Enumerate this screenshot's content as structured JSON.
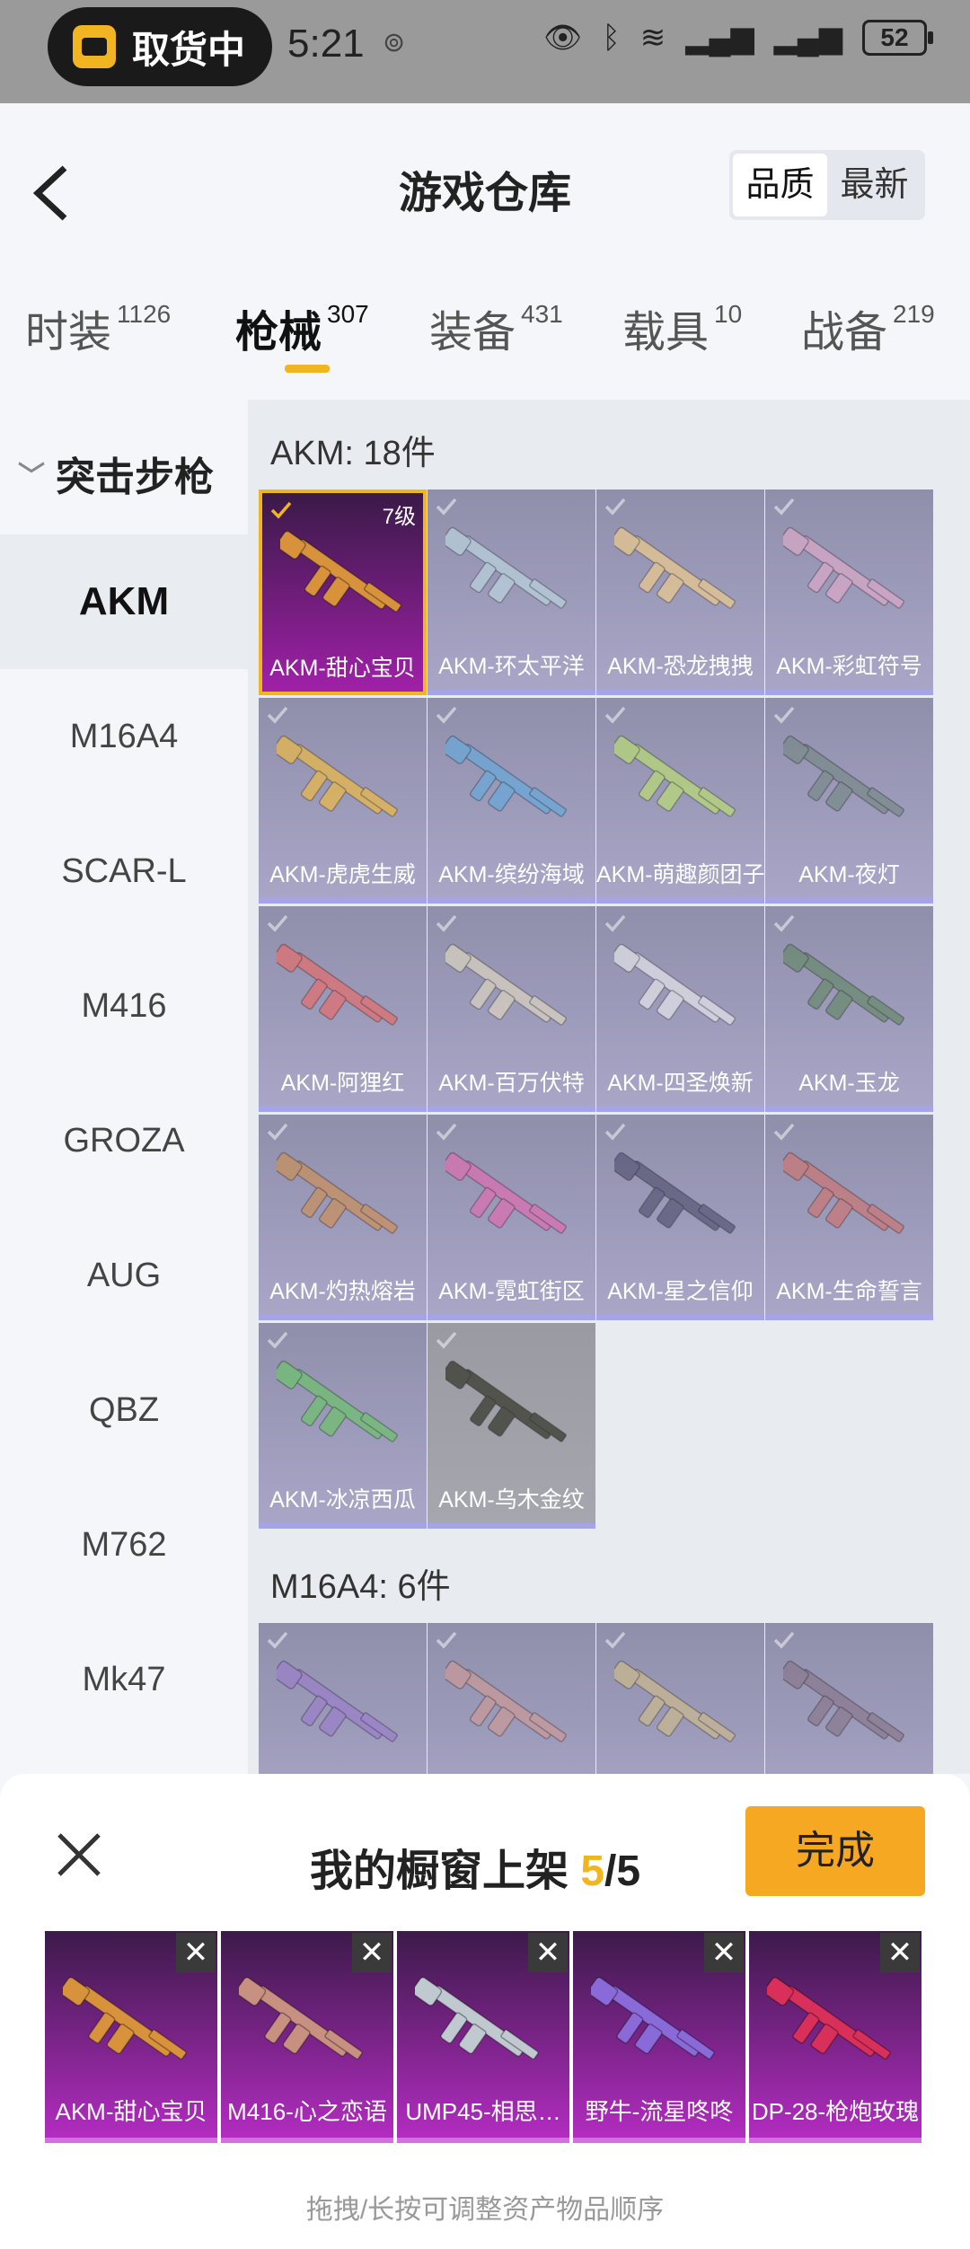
{
  "status": {
    "pill_text": "取货中",
    "time": "5:21",
    "battery": "52"
  },
  "header": {
    "title": "游戏仓库",
    "sort_options": [
      "品质",
      "最新"
    ]
  },
  "tabs": [
    {
      "label": "时装",
      "count": "1126"
    },
    {
      "label": "枪械",
      "count": "307"
    },
    {
      "label": "装备",
      "count": "431"
    },
    {
      "label": "载具",
      "count": "10"
    },
    {
      "label": "战备",
      "count": "219"
    }
  ],
  "sidebar": {
    "category": "突击步枪",
    "items": [
      "AKM",
      "M16A4",
      "SCAR-L",
      "M416",
      "GROZA",
      "AUG",
      "QBZ",
      "M762",
      "Mk47"
    ]
  },
  "sections": [
    {
      "title": "AKM: 18件",
      "items": [
        {
          "name": "AKM-甜心宝贝",
          "level": "7级",
          "color": "#d8923c"
        },
        {
          "name": "AKM-环太平洋",
          "color": "#b8d0dc"
        },
        {
          "name": "AKM-恐龙拽拽",
          "color": "#e8c890"
        },
        {
          "name": "AKM-彩虹符号",
          "color": "#d8a8c8"
        },
        {
          "name": "AKM-虎虎生威",
          "color": "#e8b84c"
        },
        {
          "name": "AKM-缤纷海域",
          "color": "#6aa8d8"
        },
        {
          "name": "AKM-萌趣颜团子",
          "color": "#b8d878"
        },
        {
          "name": "AKM-夜灯",
          "color": "#7a8a8a"
        },
        {
          "name": "AKM-阿狸红",
          "color": "#e07070"
        },
        {
          "name": "AKM-百万伏特",
          "color": "#d8d0c0"
        },
        {
          "name": "AKM-四圣焕新",
          "color": "#e0e0e8"
        },
        {
          "name": "AKM-玉龙",
          "color": "#6a8a70"
        },
        {
          "name": "AKM-灼热熔岩",
          "color": "#c89060"
        },
        {
          "name": "AKM-霓虹街区",
          "color": "#d870b0"
        },
        {
          "name": "AKM-星之信仰",
          "color": "#5a5a78"
        },
        {
          "name": "AKM-生命誓言",
          "color": "#c87878"
        },
        {
          "name": "AKM-冰凉西瓜",
          "color": "#70c070"
        },
        {
          "name": "AKM-乌木金纹",
          "color": "#3a3a30"
        }
      ]
    },
    {
      "title": "M16A4: 6件",
      "items": [
        {
          "name": "",
          "color": "#9a80c8"
        },
        {
          "name": "",
          "color": "#c89a9a"
        },
        {
          "name": "",
          "color": "#c8b890"
        },
        {
          "name": "",
          "color": "#8a7a90"
        }
      ]
    }
  ],
  "sheet": {
    "title_prefix": "我的橱窗上架 ",
    "count_current": "5",
    "count_total": "/5",
    "done_label": "完成",
    "shelf": [
      {
        "name": "AKM-甜心宝贝",
        "color": "#d8923c"
      },
      {
        "name": "M416-心之恋语",
        "color": "#c89080"
      },
      {
        "name": "UMP45-相思…",
        "color": "#c0c8d0"
      },
      {
        "name": "野牛-流星咚咚",
        "color": "#8a6ad8"
      },
      {
        "name": "DP-28-枪炮玫瑰",
        "color": "#d8305a"
      }
    ],
    "hint": "拖拽/长按可调整资产物品顺序"
  }
}
